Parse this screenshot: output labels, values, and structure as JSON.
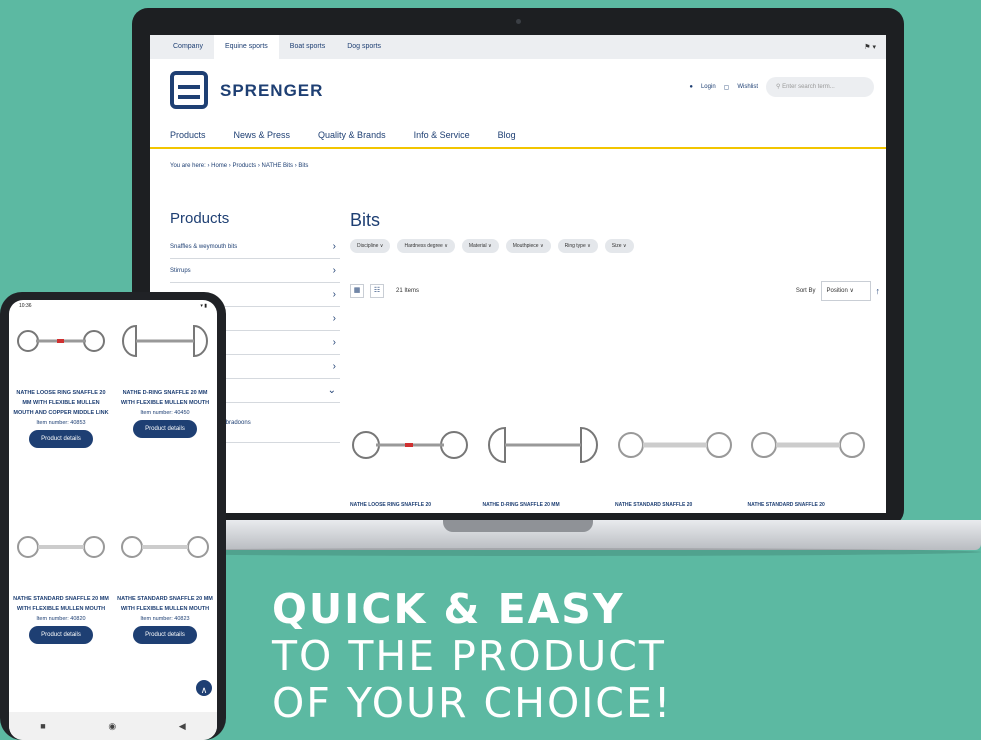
{
  "laptop": {
    "topnav": [
      "Company",
      "Equine sports",
      "Boat sports",
      "Dog sports"
    ],
    "lang": "⚑ ▾",
    "brand": "SPRENGER",
    "login": "Login",
    "wishlist": "Wishlist",
    "search_placeholder": "Enter search term...",
    "mainnav": [
      "Products",
      "News & Press",
      "Quality & Brands",
      "Info & Service",
      "Blog"
    ],
    "breadcrumb": "You are here: › Home › Products › NATHE Bits › Bits",
    "sidebar": {
      "title": "Products",
      "items": [
        "Snaffles & weymouth bits",
        "Stirrups",
        "",
        "",
        "",
        "",
        ""
      ]
    },
    "page_title": "Bits",
    "filters": [
      "Discipline ∨",
      "Hardness degree ∨",
      "Material ∨",
      "Mouthpiece ∨",
      "Ring type ∨",
      "Size ∨"
    ],
    "items_count": "21 Items",
    "sort_label": "Sort By",
    "sort_value": "Position ∨",
    "products": [
      "NATHE LOOSE RING SNAFFLE 20",
      "NATHE D-RING SNAFFLE 20 MM",
      "NATHE STANDARD SNAFFLE 20",
      "NATHE STANDARD SNAFFLE 20"
    ],
    "partial_link": "& bradoons"
  },
  "phone": {
    "time": "10:36",
    "status_right": "▾ ▮",
    "products": [
      {
        "name": "NATHE LOOSE RING SNAFFLE 20 MM WITH FLEXIBLE MULLEN MOUTH AND COPPER MIDDLE LINK",
        "item": "Item number: 40853",
        "btn": "Product details"
      },
      {
        "name": "NATHE D-RING SNAFFLE 20 MM WITH FLEXIBLE MULLEN MOUTH",
        "item": "Item number: 40450",
        "btn": "Product details"
      },
      {
        "name": "NATHE STANDARD SNAFFLE 20 MM WITH FLEXIBLE MULLEN MOUTH",
        "item": "Item number: 40820",
        "btn": "Product details"
      },
      {
        "name": "NATHE STANDARD SNAFFLE 20 MM WITH FLEXIBLE MULLEN MOUTH",
        "item": "Item number: 40823",
        "btn": "Product details"
      }
    ],
    "nav": [
      "■",
      "◉",
      "◀"
    ],
    "scroll_top": "∧"
  },
  "headline": {
    "line1": "QUICK & EASY",
    "line2": "TO THE PRODUCT",
    "line3": "OF YOUR CHOICE!"
  },
  "colors": {
    "background": "#5cb9a2",
    "brand": "#1e3f73",
    "accent": "#f2c500"
  }
}
